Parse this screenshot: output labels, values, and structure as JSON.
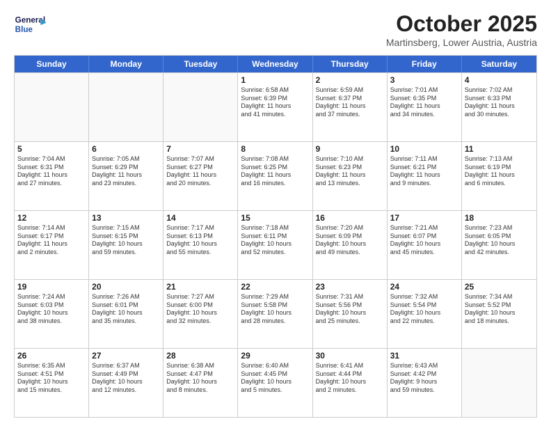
{
  "header": {
    "logo_line1": "General",
    "logo_line2": "Blue",
    "month": "October 2025",
    "location": "Martinsberg, Lower Austria, Austria"
  },
  "days_of_week": [
    "Sunday",
    "Monday",
    "Tuesday",
    "Wednesday",
    "Thursday",
    "Friday",
    "Saturday"
  ],
  "rows": [
    [
      {
        "day": "",
        "text": "",
        "empty": true
      },
      {
        "day": "",
        "text": "",
        "empty": true
      },
      {
        "day": "",
        "text": "",
        "empty": true
      },
      {
        "day": "1",
        "text": "Sunrise: 6:58 AM\nSunset: 6:39 PM\nDaylight: 11 hours\nand 41 minutes.",
        "empty": false
      },
      {
        "day": "2",
        "text": "Sunrise: 6:59 AM\nSunset: 6:37 PM\nDaylight: 11 hours\nand 37 minutes.",
        "empty": false
      },
      {
        "day": "3",
        "text": "Sunrise: 7:01 AM\nSunset: 6:35 PM\nDaylight: 11 hours\nand 34 minutes.",
        "empty": false
      },
      {
        "day": "4",
        "text": "Sunrise: 7:02 AM\nSunset: 6:33 PM\nDaylight: 11 hours\nand 30 minutes.",
        "empty": false
      }
    ],
    [
      {
        "day": "5",
        "text": "Sunrise: 7:04 AM\nSunset: 6:31 PM\nDaylight: 11 hours\nand 27 minutes.",
        "empty": false
      },
      {
        "day": "6",
        "text": "Sunrise: 7:05 AM\nSunset: 6:29 PM\nDaylight: 11 hours\nand 23 minutes.",
        "empty": false
      },
      {
        "day": "7",
        "text": "Sunrise: 7:07 AM\nSunset: 6:27 PM\nDaylight: 11 hours\nand 20 minutes.",
        "empty": false
      },
      {
        "day": "8",
        "text": "Sunrise: 7:08 AM\nSunset: 6:25 PM\nDaylight: 11 hours\nand 16 minutes.",
        "empty": false
      },
      {
        "day": "9",
        "text": "Sunrise: 7:10 AM\nSunset: 6:23 PM\nDaylight: 11 hours\nand 13 minutes.",
        "empty": false
      },
      {
        "day": "10",
        "text": "Sunrise: 7:11 AM\nSunset: 6:21 PM\nDaylight: 11 hours\nand 9 minutes.",
        "empty": false
      },
      {
        "day": "11",
        "text": "Sunrise: 7:13 AM\nSunset: 6:19 PM\nDaylight: 11 hours\nand 6 minutes.",
        "empty": false
      }
    ],
    [
      {
        "day": "12",
        "text": "Sunrise: 7:14 AM\nSunset: 6:17 PM\nDaylight: 11 hours\nand 2 minutes.",
        "empty": false
      },
      {
        "day": "13",
        "text": "Sunrise: 7:15 AM\nSunset: 6:15 PM\nDaylight: 10 hours\nand 59 minutes.",
        "empty": false
      },
      {
        "day": "14",
        "text": "Sunrise: 7:17 AM\nSunset: 6:13 PM\nDaylight: 10 hours\nand 55 minutes.",
        "empty": false
      },
      {
        "day": "15",
        "text": "Sunrise: 7:18 AM\nSunset: 6:11 PM\nDaylight: 10 hours\nand 52 minutes.",
        "empty": false
      },
      {
        "day": "16",
        "text": "Sunrise: 7:20 AM\nSunset: 6:09 PM\nDaylight: 10 hours\nand 49 minutes.",
        "empty": false
      },
      {
        "day": "17",
        "text": "Sunrise: 7:21 AM\nSunset: 6:07 PM\nDaylight: 10 hours\nand 45 minutes.",
        "empty": false
      },
      {
        "day": "18",
        "text": "Sunrise: 7:23 AM\nSunset: 6:05 PM\nDaylight: 10 hours\nand 42 minutes.",
        "empty": false
      }
    ],
    [
      {
        "day": "19",
        "text": "Sunrise: 7:24 AM\nSunset: 6:03 PM\nDaylight: 10 hours\nand 38 minutes.",
        "empty": false
      },
      {
        "day": "20",
        "text": "Sunrise: 7:26 AM\nSunset: 6:01 PM\nDaylight: 10 hours\nand 35 minutes.",
        "empty": false
      },
      {
        "day": "21",
        "text": "Sunrise: 7:27 AM\nSunset: 6:00 PM\nDaylight: 10 hours\nand 32 minutes.",
        "empty": false
      },
      {
        "day": "22",
        "text": "Sunrise: 7:29 AM\nSunset: 5:58 PM\nDaylight: 10 hours\nand 28 minutes.",
        "empty": false
      },
      {
        "day": "23",
        "text": "Sunrise: 7:31 AM\nSunset: 5:56 PM\nDaylight: 10 hours\nand 25 minutes.",
        "empty": false
      },
      {
        "day": "24",
        "text": "Sunrise: 7:32 AM\nSunset: 5:54 PM\nDaylight: 10 hours\nand 22 minutes.",
        "empty": false
      },
      {
        "day": "25",
        "text": "Sunrise: 7:34 AM\nSunset: 5:52 PM\nDaylight: 10 hours\nand 18 minutes.",
        "empty": false
      }
    ],
    [
      {
        "day": "26",
        "text": "Sunrise: 6:35 AM\nSunset: 4:51 PM\nDaylight: 10 hours\nand 15 minutes.",
        "empty": false
      },
      {
        "day": "27",
        "text": "Sunrise: 6:37 AM\nSunset: 4:49 PM\nDaylight: 10 hours\nand 12 minutes.",
        "empty": false
      },
      {
        "day": "28",
        "text": "Sunrise: 6:38 AM\nSunset: 4:47 PM\nDaylight: 10 hours\nand 8 minutes.",
        "empty": false
      },
      {
        "day": "29",
        "text": "Sunrise: 6:40 AM\nSunset: 4:45 PM\nDaylight: 10 hours\nand 5 minutes.",
        "empty": false
      },
      {
        "day": "30",
        "text": "Sunrise: 6:41 AM\nSunset: 4:44 PM\nDaylight: 10 hours\nand 2 minutes.",
        "empty": false
      },
      {
        "day": "31",
        "text": "Sunrise: 6:43 AM\nSunset: 4:42 PM\nDaylight: 9 hours\nand 59 minutes.",
        "empty": false
      },
      {
        "day": "",
        "text": "",
        "empty": true
      }
    ]
  ]
}
